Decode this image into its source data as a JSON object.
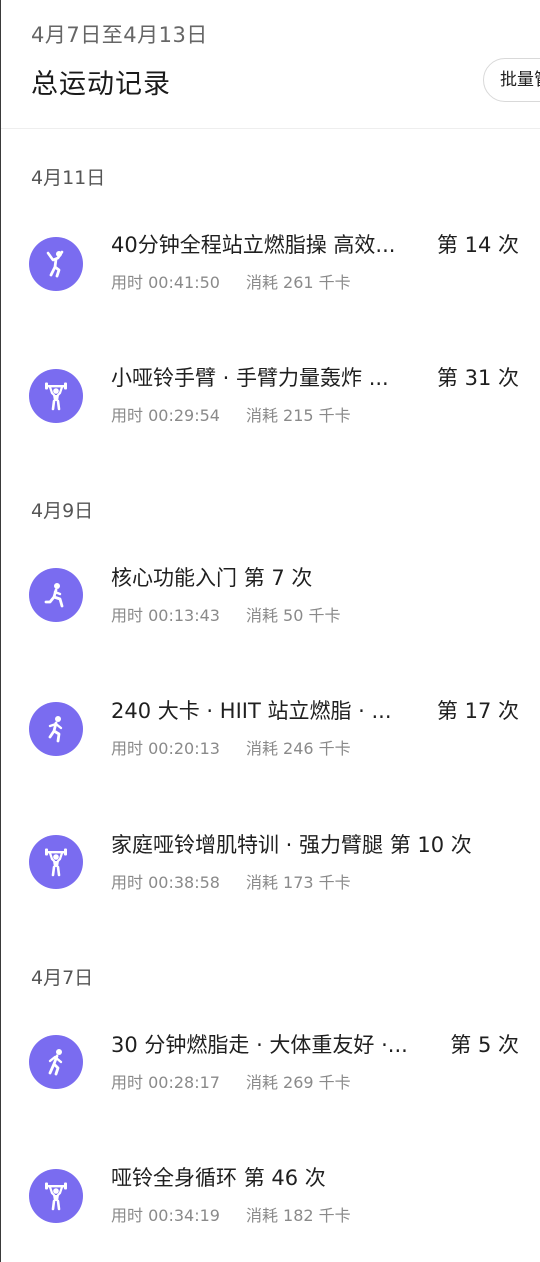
{
  "header": {
    "date_range": "4月7日至4月13日",
    "title": "总运动记录",
    "batch_label": "批量管"
  },
  "colors": {
    "accent": "#7a6cf0"
  },
  "groups": [
    {
      "date": "4月11日",
      "records": [
        {
          "icon": "jumping-person-icon",
          "title": "40分钟全程站立燃脂操 高效...",
          "count": "第 14 次",
          "duration": "用时 00:41:50",
          "calories": "消耗 261 千卡"
        },
        {
          "icon": "dumbbell-person-icon",
          "title": "小哑铃手臂 · 手臂力量轰炸 ...",
          "count": "第 31 次",
          "duration": "用时 00:29:54",
          "calories": "消耗 215 千卡"
        }
      ]
    },
    {
      "date": "4月9日",
      "records": [
        {
          "icon": "lunge-person-icon",
          "title": "核心功能入门",
          "count": "第 7 次",
          "duration": "用时 00:13:43",
          "calories": "消耗 50 千卡"
        },
        {
          "icon": "running-person-icon",
          "title": "240 大卡 · HIIT 站立燃脂 · ...",
          "count": "第 17 次",
          "duration": "用时 00:20:13",
          "calories": "消耗 246 千卡"
        },
        {
          "icon": "dumbbell-person-icon",
          "title": "家庭哑铃增肌特训 · 强力臂腿",
          "count": "第 10 次",
          "duration": "用时 00:38:58",
          "calories": "消耗 173 千卡"
        }
      ]
    },
    {
      "date": "4月7日",
      "records": [
        {
          "icon": "walking-person-icon",
          "title": "30 分钟燃脂走 · 大体重友好 ·...",
          "count": "第 5 次",
          "duration": "用时 00:28:17",
          "calories": "消耗 269 千卡"
        },
        {
          "icon": "dumbbell-person-icon",
          "title": "哑铃全身循环",
          "count": "第 46 次",
          "duration": "用时 00:34:19",
          "calories": "消耗 182 千卡"
        }
      ]
    }
  ]
}
